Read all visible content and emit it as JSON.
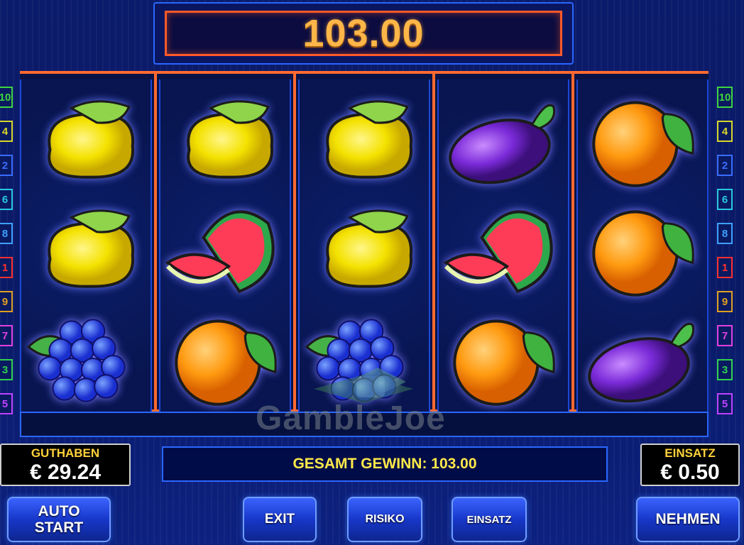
{
  "win": {
    "amount": "103.00"
  },
  "reels": [
    [
      "lemon",
      "lemon",
      "grapes"
    ],
    [
      "lemon",
      "melon",
      "orange"
    ],
    [
      "lemon",
      "lemon",
      "grapes"
    ],
    [
      "plum",
      "melon",
      "orange"
    ],
    [
      "orange",
      "orange",
      "plum"
    ]
  ],
  "lines": {
    "left": [
      "10",
      "4",
      "2",
      "6",
      "8",
      "1",
      "9",
      "7",
      "3",
      "5"
    ],
    "right": [
      "10",
      "4",
      "2",
      "6",
      "8",
      "1",
      "9",
      "7",
      "3",
      "5"
    ],
    "colors": {
      "10": "#3ed43e",
      "4": "#d6d62a",
      "2": "#3a6cff",
      "6": "#29c7e0",
      "8": "#3fa0ff",
      "1": "#ff3030",
      "9": "#e0a020",
      "7": "#e040e0",
      "3": "#30d050",
      "5": "#c040ff"
    }
  },
  "balance": {
    "label": "GUTHABEN",
    "value": "€ 29.24"
  },
  "bet": {
    "label": "EINSATZ",
    "value": "€ 0.50"
  },
  "total_win_text": "GESAMT GEWINN: 103.00",
  "buttons": {
    "auto_line1": "AUTO",
    "auto_line2": "START",
    "exit": "EXIT",
    "risiko": "RISIKO",
    "einsatz": "EINSATZ",
    "nehmen": "NEHMEN"
  },
  "watermark": "GambleJoe"
}
